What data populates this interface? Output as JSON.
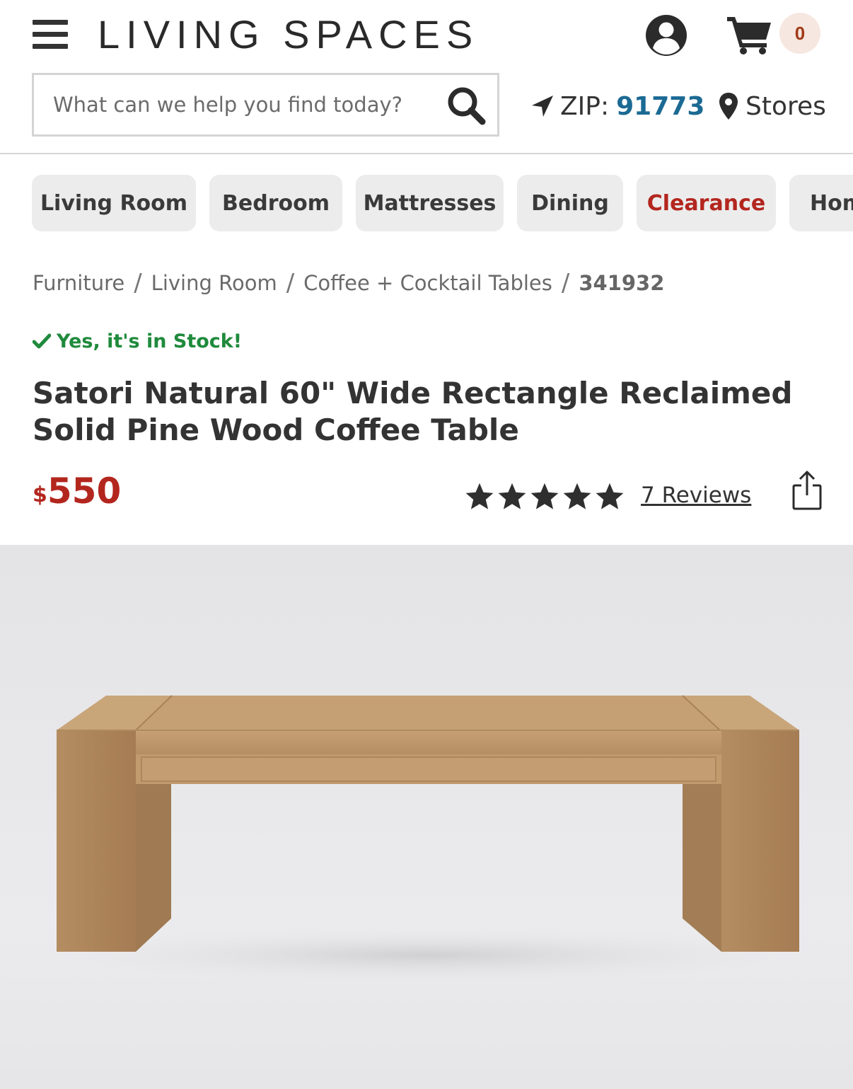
{
  "header": {
    "logo": "LIVING SPACES",
    "cart_count": "0"
  },
  "search": {
    "placeholder": "What can we help you find today?"
  },
  "location": {
    "zip_label": "ZIP:",
    "zip_value": "91773",
    "stores_label": "Stores"
  },
  "categories": [
    {
      "label": "Living Room"
    },
    {
      "label": "Bedroom"
    },
    {
      "label": "Mattresses"
    },
    {
      "label": "Dining"
    },
    {
      "label": "Clearance"
    },
    {
      "label": "Hom"
    }
  ],
  "breadcrumb": {
    "items": [
      "Furniture",
      "Living Room",
      "Coffee + Cocktail Tables"
    ],
    "sku": "341932"
  },
  "product": {
    "stock_status": "Yes, it's in Stock!",
    "title": "Satori Natural 60\" Wide Rectangle Reclaimed Solid Pine Wood Coffee Table",
    "price_currency": "$",
    "price_amount": "550",
    "rating": 5,
    "rating_max": 5,
    "reviews_label": "7 Reviews"
  },
  "colors": {
    "price_red": "#b3261e",
    "stock_green": "#1f8a3c",
    "zip_blue": "#1b6a94",
    "cart_badge_bg": "#f6e7e0"
  },
  "icons": [
    "menu-icon",
    "account-icon",
    "cart-icon",
    "search-icon",
    "location-arrow-icon",
    "map-pin-icon",
    "checkmark-icon",
    "star-icon",
    "share-icon"
  ]
}
